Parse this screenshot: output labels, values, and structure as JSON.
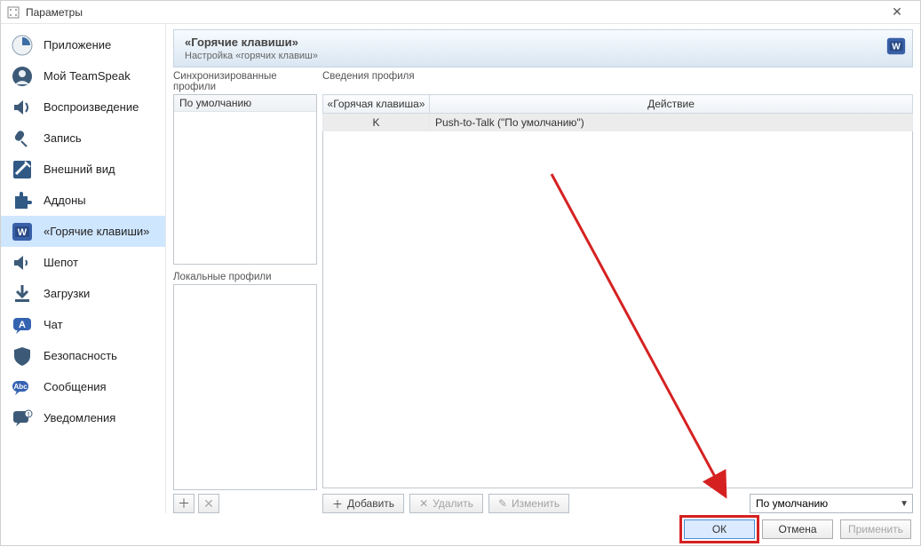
{
  "window": {
    "title": "Параметры"
  },
  "sidebar": {
    "items": [
      {
        "label": "Приложение"
      },
      {
        "label": "Мой TeamSpeak"
      },
      {
        "label": "Воспроизведение"
      },
      {
        "label": "Запись"
      },
      {
        "label": "Внешний вид"
      },
      {
        "label": "Аддоны"
      },
      {
        "label": "«Горячие клавиши»"
      },
      {
        "label": "Шепот"
      },
      {
        "label": "Загрузки"
      },
      {
        "label": "Чат"
      },
      {
        "label": "Безопасность"
      },
      {
        "label": "Сообщения"
      },
      {
        "label": "Уведомления"
      }
    ]
  },
  "header": {
    "title": "«Горячие клавиши»",
    "subtitle": "Настройка «горячих клавиш»"
  },
  "columns": {
    "sync_profiles": "Синхронизированные профили",
    "profile_details": "Сведения профиля"
  },
  "left": {
    "default_row": "По умолчанию",
    "local_profiles_label": "Локальные профили"
  },
  "grid": {
    "headers": {
      "hotkey": "«Горячая клавиша»",
      "action": "Действие"
    },
    "rows": [
      {
        "hotkey": "K",
        "action": "Push-to-Talk (\"По умолчанию\")"
      }
    ]
  },
  "toolbar": {
    "add": "Добавить",
    "delete": "Удалить",
    "edit": "Изменить",
    "combo_value": "По умолчанию"
  },
  "footer": {
    "ok": "ОК",
    "cancel": "Отмена",
    "apply": "Применить"
  }
}
